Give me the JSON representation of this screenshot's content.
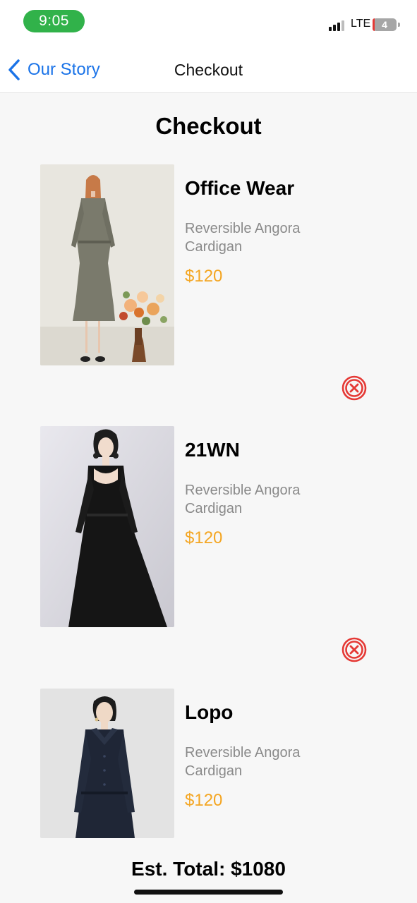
{
  "status_bar": {
    "time": "9:05",
    "network": "LTE",
    "battery": "4"
  },
  "nav": {
    "back_label": "Our Story",
    "title": "Checkout"
  },
  "heading": "Checkout",
  "items": [
    {
      "name": "Office Wear",
      "description": "Reversible Angora Cardigan",
      "price": "$120",
      "image": "grey-dress-photo"
    },
    {
      "name": "21WN",
      "description": "Reversible Angora Cardigan",
      "price": "$120",
      "image": "black-dress-photo"
    },
    {
      "name": "Lopo",
      "description": "Reversible Angora Cardigan",
      "price": "$120",
      "image": "navy-dress-photo"
    }
  ],
  "remove_icon": "close-circle-icon",
  "total": "Est. Total: $1080",
  "colors": {
    "accent": "#1a73e8",
    "price": "#f4a623",
    "remove": "#e53935",
    "time_pill": "#31b24a"
  }
}
